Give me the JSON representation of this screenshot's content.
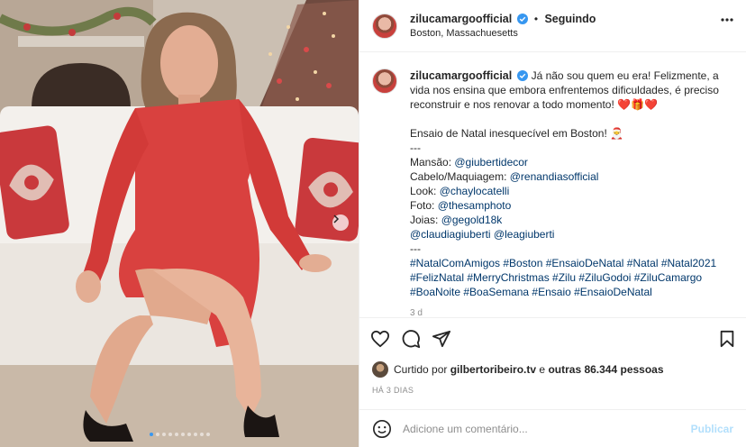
{
  "post": {
    "username": "zilucamargoofficial",
    "follow_status": "Seguindo",
    "bullet": "•",
    "location": "Boston, Massachuesetts",
    "caption": {
      "line1": "Já não sou quem eu era! Felizmente, a vida nos ensina que embora enfrentemos dificuldades, é preciso reconstruir e nos renovar a todo momento! ❤️🎁❤️",
      "line2": "Ensaio de Natal inesquecível em Boston! 🎅",
      "sep1": "---",
      "credits": [
        {
          "label": "Mansão: ",
          "handle": "@giubertidecor"
        },
        {
          "label": "Cabelo/Maquiagem: ",
          "handle": "@renandiasofficial"
        },
        {
          "label": "Look: ",
          "handle": "@chaylocatelli"
        },
        {
          "label": "Foto: ",
          "handle": "@thesamphoto"
        },
        {
          "label": "Joias: ",
          "handle": "@gegold18k"
        }
      ],
      "extra_handles": [
        "@claudiagiuberti",
        "@leagiuberti"
      ],
      "sep2": "---",
      "hashtags": "#NatalComAmigos #Boston #EnsaioDeNatal #Natal #Natal2021 #FelizNatal #MerryChristmas #Zilu #ZiluGodoi #ZiluCamargo #BoaNoite #BoaSemana #Ensaio #EnsaioDeNatal",
      "cut_text": "3 d"
    },
    "likes": {
      "prefix": "Curtido por",
      "liker": "gilbertoribeiro.tv",
      "middle": "e",
      "others": "outras 86.344 pessoas"
    },
    "time_ago": "HÁ 3 DIAS",
    "comment_placeholder": "Adicione um comentário...",
    "publish_label": "Publicar"
  },
  "carousel": {
    "count": 10,
    "active_index": 0
  },
  "icons": {
    "verified": "verified-badge-icon",
    "more": "more-options-icon",
    "like": "heart-icon",
    "comment": "comment-icon",
    "share": "share-icon",
    "save": "bookmark-icon",
    "emoji": "emoji-icon",
    "next": "chevron-right-icon"
  },
  "colors": {
    "link": "#00376b",
    "verified": "#3797f0",
    "publish": "#b2dffc",
    "dress": "#d9413f"
  }
}
